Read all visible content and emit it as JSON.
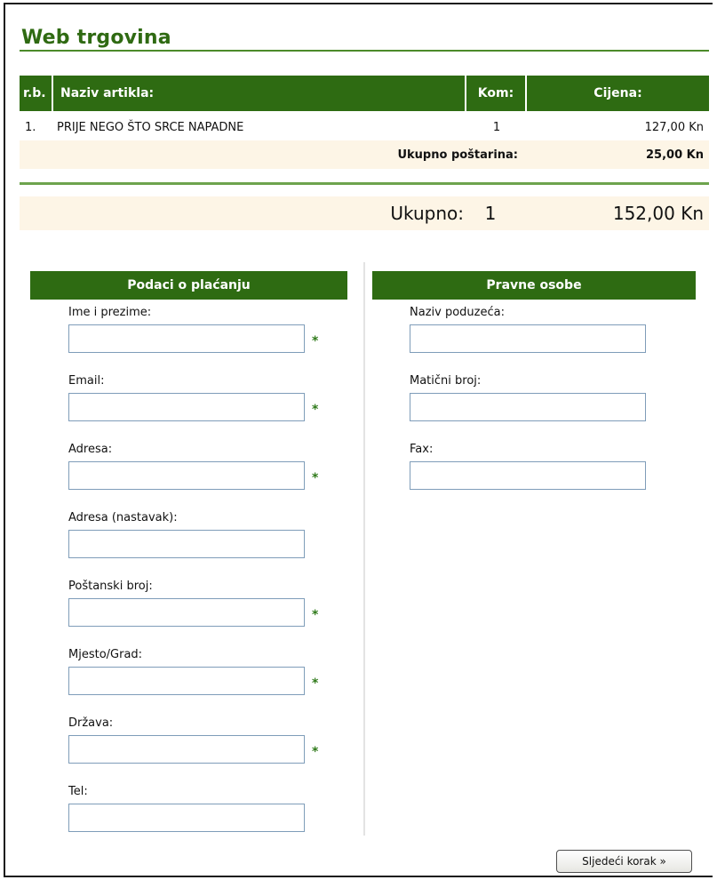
{
  "page": {
    "title": "Web trgovina"
  },
  "cart": {
    "headers": {
      "rb": "r.b.",
      "name": "Naziv artikla:",
      "qty": "Kom:",
      "price": "Cijena:"
    },
    "items": [
      {
        "rb": "1.",
        "name": "PRIJE NEGO ŠTO SRCE NAPADNE",
        "qty": "1",
        "price": "127,00 Kn"
      }
    ],
    "shipping": {
      "label": "Ukupno poštarina:",
      "value": "25,00 Kn"
    },
    "total": {
      "label": "Ukupno:",
      "qty": "1",
      "price": "152,00 Kn"
    }
  },
  "payment": {
    "heading": "Podaci o plaćanju",
    "required_mark": "*",
    "fields": [
      {
        "label": "Ime i prezime:",
        "value": "",
        "required": true
      },
      {
        "label": "Email:",
        "value": "",
        "required": true
      },
      {
        "label": "Adresa:",
        "value": "",
        "required": true
      },
      {
        "label": "Adresa (nastavak):",
        "value": "",
        "required": false
      },
      {
        "label": "Poštanski broj:",
        "value": "",
        "required": true
      },
      {
        "label": "Mjesto/Grad:",
        "value": "",
        "required": true
      },
      {
        "label": "Država:",
        "value": "",
        "required": true
      },
      {
        "label": "Tel:",
        "value": "",
        "required": false
      }
    ]
  },
  "company": {
    "heading": "Pravne osobe",
    "fields": [
      {
        "label": "Naziv poduzeća:",
        "value": ""
      },
      {
        "label": "Matični broj:",
        "value": ""
      },
      {
        "label": "Fax:",
        "value": ""
      }
    ]
  },
  "actions": {
    "next_label": "Sljedeći korak  »"
  },
  "colors": {
    "header_green": "#2e6b12",
    "title_green": "#2f6a12",
    "row_beige": "#fdf5e6",
    "asterisk_green": "#2f7a1a"
  }
}
